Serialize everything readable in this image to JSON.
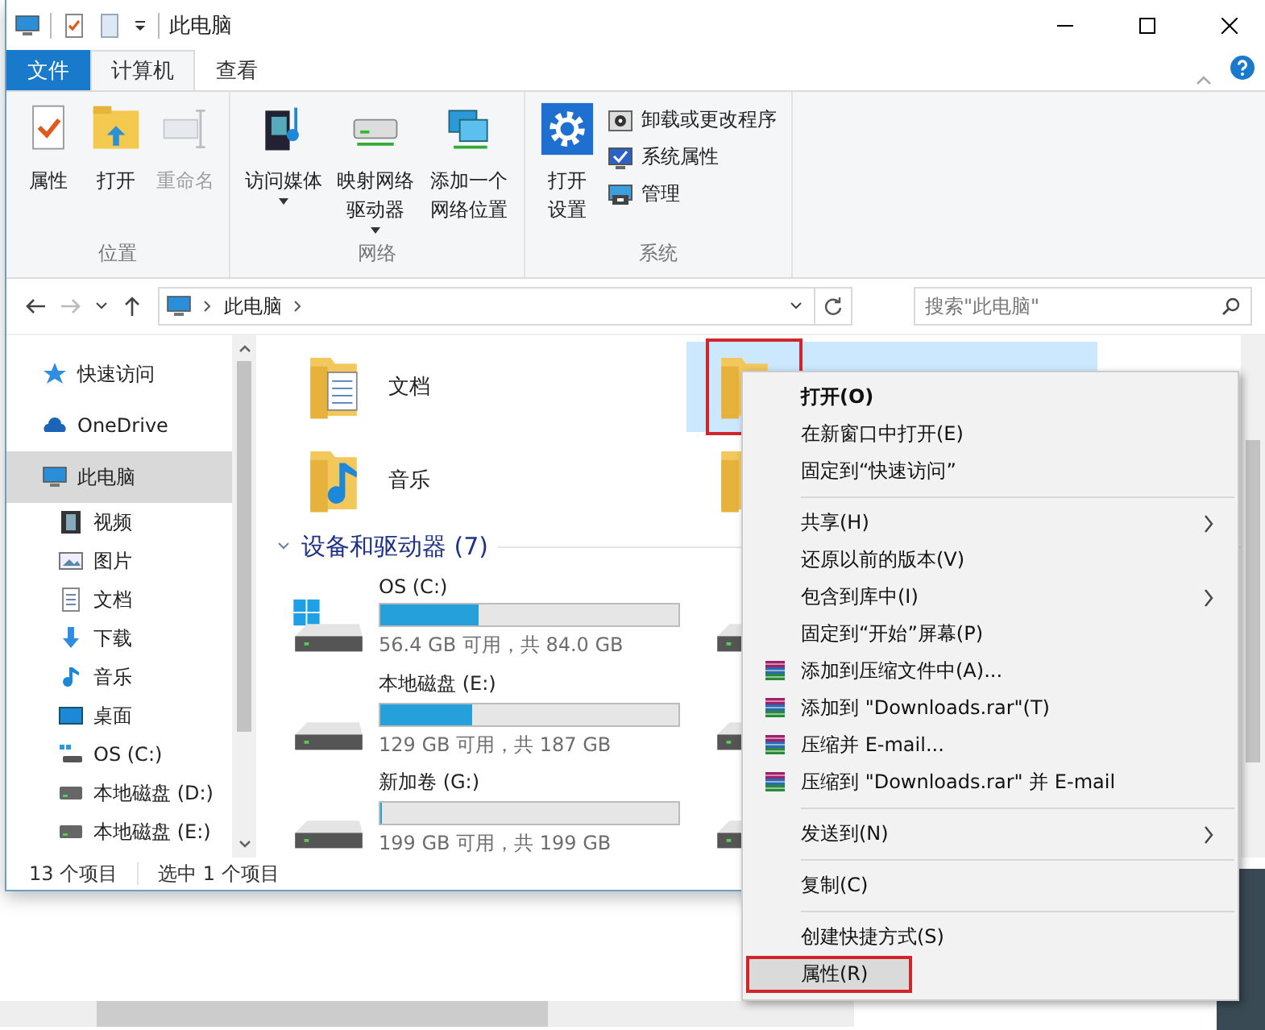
{
  "window": {
    "title": "此电脑"
  },
  "ribbon_tabs": [
    {
      "label": "文件",
      "kind": "file",
      "selected": false
    },
    {
      "label": "计算机",
      "kind": "tab",
      "selected": true
    },
    {
      "label": "查看",
      "kind": "tab",
      "selected": false
    }
  ],
  "ribbon_groups": [
    {
      "label": "位置",
      "buttons": [
        {
          "label": "属性",
          "kind": "properties",
          "disabled": false
        },
        {
          "label": "打开",
          "kind": "open",
          "disabled": false
        },
        {
          "label": "重命名",
          "kind": "rename",
          "disabled": true
        }
      ]
    },
    {
      "label": "网络",
      "buttons": [
        {
          "label": "访问媒体",
          "kind": "media",
          "disabled": false,
          "dropdown": true
        },
        {
          "label": "映射网络驱动器",
          "kind": "mapdrive",
          "disabled": false,
          "dropdown": true
        },
        {
          "label": "添加一个网络位置",
          "kind": "netloc",
          "disabled": false
        }
      ]
    },
    {
      "label": "系统",
      "buttons": [
        {
          "label": "打开设置",
          "kind": "settings",
          "disabled": false
        }
      ],
      "small_buttons": [
        {
          "label": "卸载或更改程序",
          "kind": "uninstall"
        },
        {
          "label": "系统属性",
          "kind": "sysprops"
        },
        {
          "label": "管理",
          "kind": "manage"
        }
      ]
    }
  ],
  "address": {
    "path": "此电脑",
    "search_placeholder": "搜索\"此电脑\""
  },
  "sidebar": {
    "items": [
      {
        "label": "快速访问",
        "kind": "star",
        "selected": false
      },
      {
        "label": "OneDrive",
        "kind": "cloud",
        "selected": false
      },
      {
        "label": "此电脑",
        "kind": "pc",
        "selected": true,
        "children": [
          {
            "label": "视频",
            "kind": "video",
            "selected": false
          },
          {
            "label": "图片",
            "kind": "picture",
            "selected": false
          },
          {
            "label": "文档",
            "kind": "doc",
            "selected": false
          },
          {
            "label": "下载",
            "kind": "download",
            "selected": false
          },
          {
            "label": "音乐",
            "kind": "music",
            "selected": false
          },
          {
            "label": "桌面",
            "kind": "desktop",
            "selected": false
          },
          {
            "label": "OS (C:)",
            "kind": "osdrive",
            "selected": false
          },
          {
            "label": "本地磁盘 (D:)",
            "kind": "drive",
            "selected": false
          },
          {
            "label": "本地磁盘 (E:)",
            "kind": "drive",
            "selected": false
          }
        ]
      }
    ]
  },
  "folders": [
    {
      "label": "文档",
      "kind": "documents",
      "selected": false,
      "marked": false
    },
    {
      "kind": "plain",
      "selected": true,
      "marked": true
    },
    {
      "label": "音乐",
      "kind": "music",
      "selected": false,
      "marked": false
    },
    {
      "kind": "plain",
      "selected": false,
      "marked": false
    }
  ],
  "drives_group": {
    "label": "设备和驱动器 (7)",
    "expanded": true
  },
  "drives": [
    {
      "name": "OS (C:)",
      "kind": "system",
      "level": 0.33,
      "space": "56.4 GB 可用，共 84.0 GB"
    },
    {
      "kind": "hdd"
    },
    {
      "name": "本地磁盘 (E:)",
      "kind": "hdd",
      "level": 0.31,
      "space": "129 GB 可用，共 187 GB"
    },
    {
      "kind": "hdd"
    },
    {
      "name": "新加卷 (G:)",
      "kind": "hdd",
      "level": 0.0,
      "space": "199 GB 可用，共 199 GB"
    },
    {
      "kind": "hdd"
    }
  ],
  "status_bar": {
    "count": "13 个项目",
    "selection": "选中 1 个项目"
  },
  "context_menu": {
    "sections": [
      [
        {
          "label": "打开(O)",
          "bold": true
        },
        {
          "label": "在新窗口中打开(E)"
        },
        {
          "label": "固定到“快速访问”"
        }
      ],
      [
        {
          "label": "共享(H)",
          "submenu": true
        },
        {
          "label": "还原以前的版本(V)"
        },
        {
          "label": "包含到库中(I)",
          "submenu": true
        },
        {
          "label": "固定到“开始”屏幕(P)"
        },
        {
          "label": "添加到压缩文件中(A)...",
          "kind": "archive"
        },
        {
          "label": "添加到 \"Downloads.rar\"(T)",
          "kind": "archive"
        },
        {
          "label": "压缩并 E-mail...",
          "kind": "archive"
        },
        {
          "label": "压缩到 \"Downloads.rar\" 并 E-mail",
          "kind": "archive"
        }
      ],
      [
        {
          "label": "发送到(N)",
          "submenu": true
        }
      ],
      [
        {
          "label": "复制(C)"
        }
      ],
      [
        {
          "label": "创建快捷方式(S)"
        },
        {
          "label": "属性(R)",
          "selected": true,
          "marked": true
        }
      ]
    ]
  }
}
